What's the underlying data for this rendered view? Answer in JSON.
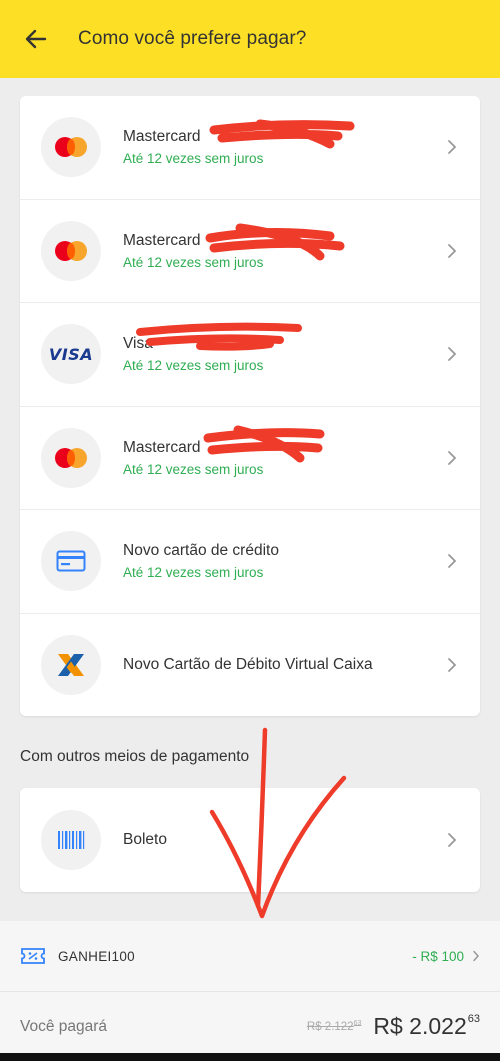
{
  "header": {
    "title": "Como você prefere pagar?"
  },
  "cards": [
    {
      "brand": "mastercard-icon",
      "title": "Mastercard",
      "subtitle": "Até 12 vezes sem juros"
    },
    {
      "brand": "mastercard-icon",
      "title": "Mastercard",
      "subtitle": "Até 12 vezes sem juros"
    },
    {
      "brand": "visa-icon",
      "icon_text": "VISA",
      "title": "Visa",
      "subtitle": "Até 12 vezes sem juros"
    },
    {
      "brand": "mastercard-icon",
      "title": "Mastercard",
      "subtitle": "Até 12 vezes sem juros"
    },
    {
      "brand": "credit-card-icon",
      "title": "Novo cartão de crédito",
      "subtitle": "Até 12 vezes sem juros"
    },
    {
      "brand": "caixa-icon",
      "title": "Novo Cartão de Débito Virtual Caixa"
    }
  ],
  "other_methods": {
    "title": "Com outros meios de pagamento",
    "items": [
      {
        "brand": "barcode-icon",
        "title": "Boleto"
      }
    ]
  },
  "footer": {
    "coupon_code": "GANHEI100",
    "coupon_discount": "- R$ 100",
    "pay_label": "Você pagará",
    "old_price": "R$ 2.122",
    "old_price_cents": "63",
    "total_price": "R$ 2.022",
    "total_cents": "63"
  },
  "colors": {
    "header_bg": "#fde026",
    "accent_green": "#2fae52",
    "annotation_red": "#ee3b2a"
  }
}
